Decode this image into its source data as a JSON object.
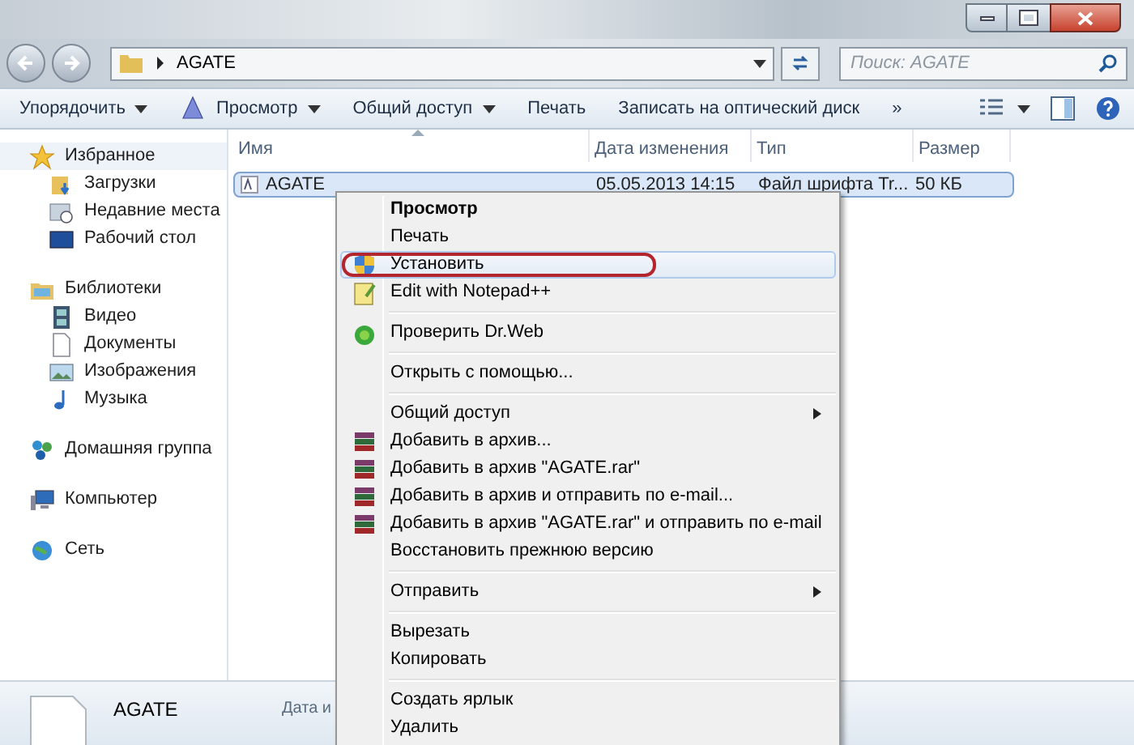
{
  "address": {
    "path": "AGATE"
  },
  "search": {
    "placeholder": "Поиск: AGATE"
  },
  "toolbar": {
    "items": [
      {
        "label": "Упорядочить",
        "dropdown": true,
        "kind": "plain"
      },
      {
        "label": "Просмотр",
        "dropdown": true,
        "kind": "view"
      },
      {
        "label": "Общий доступ",
        "dropdown": true,
        "kind": "plain"
      },
      {
        "label": "Печать",
        "dropdown": false,
        "kind": "plain"
      },
      {
        "label": "Записать на оптический диск",
        "dropdown": false,
        "kind": "plain"
      },
      {
        "label": "»",
        "dropdown": false,
        "kind": "plain"
      }
    ]
  },
  "sidebar": {
    "items": [
      {
        "label": "Избранное",
        "kind": "star",
        "selected": true,
        "children": [
          {
            "label": "Загрузки",
            "kind": "downloads",
            "selected": false
          },
          {
            "label": "Недавние места",
            "kind": "recent",
            "selected": false
          },
          {
            "label": "Рабочий стол",
            "kind": "desktop",
            "selected": false
          }
        ]
      },
      {
        "label": "Библиотеки",
        "kind": "libraries",
        "selected": false,
        "children": [
          {
            "label": "Видео",
            "kind": "video",
            "selected": false
          },
          {
            "label": "Документы",
            "kind": "documents",
            "selected": false
          },
          {
            "label": "Изображения",
            "kind": "images",
            "selected": false
          },
          {
            "label": "Музыка",
            "kind": "music",
            "selected": false
          }
        ]
      },
      {
        "label": "Домашняя группа",
        "kind": "homegroup",
        "selected": false
      },
      {
        "label": "Компьютер",
        "kind": "computer",
        "selected": false
      },
      {
        "label": "Сеть",
        "kind": "network",
        "selected": false
      }
    ]
  },
  "table": {
    "columns": [
      "Имя",
      "Дата изменения",
      "Тип",
      "Размер"
    ],
    "rows": [
      {
        "cells": [
          "AGATE",
          "05.05.2013 14:15",
          "Файл шрифта Tr...",
          "50 КБ"
        ],
        "selected": true
      }
    ]
  },
  "context_menu": {
    "items": [
      {
        "kind": "default",
        "label": "Просмотр",
        "highlighted": false,
        "circled": false
      },
      {
        "kind": "plain",
        "label": "Печать",
        "highlighted": false,
        "circled": false
      },
      {
        "kind": "shield",
        "label": "Установить",
        "highlighted": true,
        "circled": true
      },
      {
        "kind": "notepad",
        "label": "Edit with Notepad++",
        "highlighted": false,
        "circled": false
      },
      {
        "kind": "separator"
      },
      {
        "kind": "antivirus",
        "label": "Проверить Dr.Web",
        "highlighted": false,
        "circled": false
      },
      {
        "kind": "separator"
      },
      {
        "kind": "plain",
        "label": "Открыть с помощью...",
        "highlighted": false,
        "circled": false
      },
      {
        "kind": "separator"
      },
      {
        "kind": "submenu",
        "label": "Общий доступ",
        "highlighted": false,
        "circled": false
      },
      {
        "kind": "archive",
        "label": "Добавить в архив...",
        "highlighted": false,
        "circled": false
      },
      {
        "kind": "archive",
        "label": "Добавить в архив \"AGATE.rar\"",
        "highlighted": false,
        "circled": false
      },
      {
        "kind": "archive",
        "label": "Добавить в архив и отправить по e-mail...",
        "highlighted": false,
        "circled": false
      },
      {
        "kind": "archive",
        "label": "Добавить в архив \"AGATE.rar\" и отправить по e-mail",
        "highlighted": false,
        "circled": false
      },
      {
        "kind": "plain",
        "label": "Восстановить прежнюю версию",
        "highlighted": false,
        "circled": false
      },
      {
        "kind": "separator"
      },
      {
        "kind": "submenu",
        "label": "Отправить",
        "highlighted": false,
        "circled": false
      },
      {
        "kind": "separator"
      },
      {
        "kind": "plain",
        "label": "Вырезать",
        "highlighted": false,
        "circled": false
      },
      {
        "kind": "plain",
        "label": "Копировать",
        "highlighted": false,
        "circled": false
      },
      {
        "kind": "separator"
      },
      {
        "kind": "plain",
        "label": "Создать ярлык",
        "highlighted": false,
        "circled": false
      },
      {
        "kind": "plain",
        "label": "Удалить",
        "highlighted": false,
        "circled": false
      }
    ]
  },
  "details_pane": {
    "name": "AGATE",
    "label": "Дата и"
  }
}
